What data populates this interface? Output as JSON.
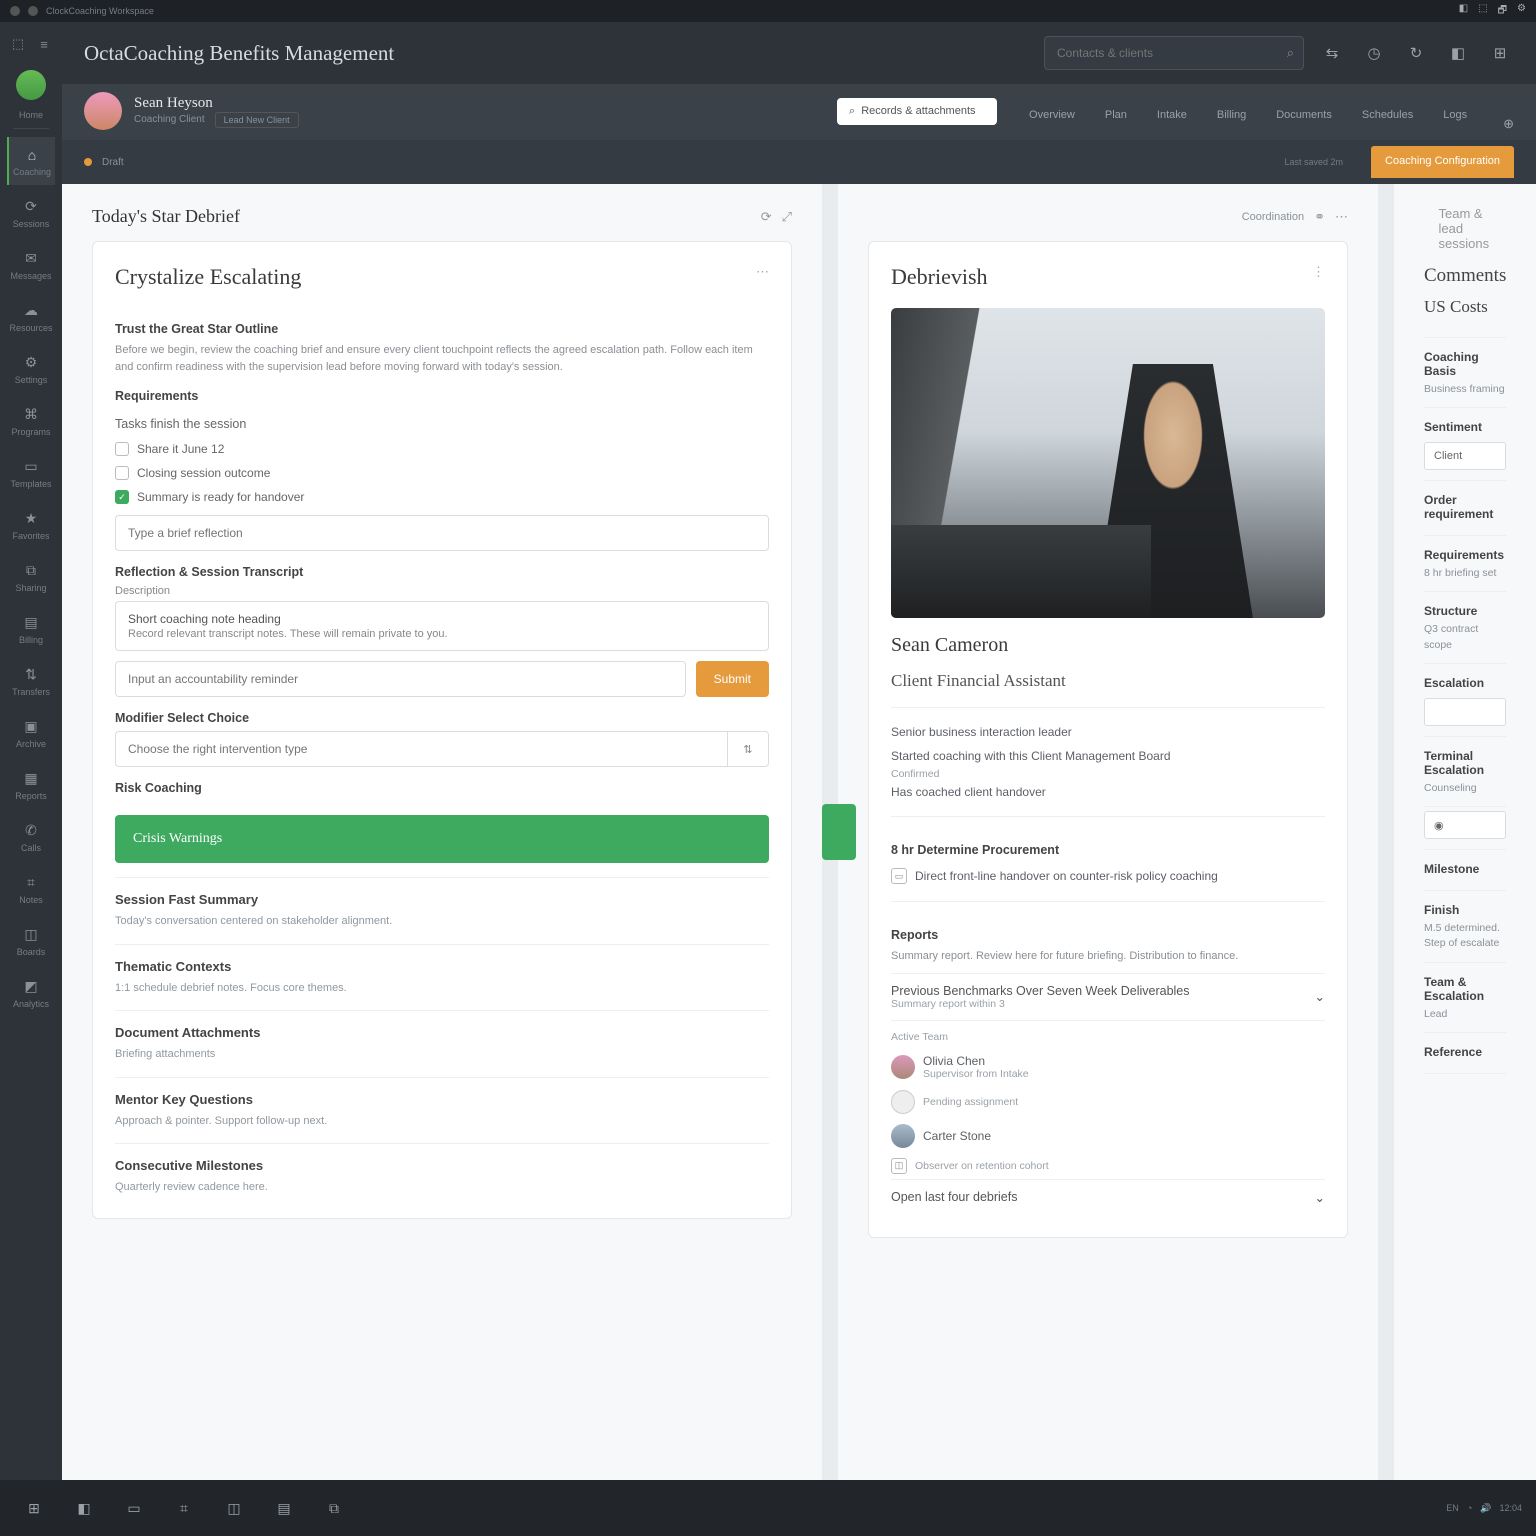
{
  "os": {
    "app_menu": "ClockCoaching Workspace",
    "tray": [
      "◧",
      "⬚",
      "🗗",
      "⚙"
    ]
  },
  "rail": {
    "items": [
      {
        "icon": "◉",
        "label": "Home"
      },
      {
        "icon": "⌂",
        "label": "Coaching",
        "sel": true
      },
      {
        "icon": "⟳",
        "label": "Sessions"
      },
      {
        "icon": "✉",
        "label": "Messages"
      },
      {
        "icon": "☁",
        "label": "Resources"
      },
      {
        "icon": "⚙",
        "label": "Settings"
      },
      {
        "icon": "⌘",
        "label": "Programs"
      },
      {
        "icon": "▭",
        "label": "Templates"
      },
      {
        "icon": "★",
        "label": "Favorites"
      },
      {
        "icon": "⧉",
        "label": "Sharing"
      },
      {
        "icon": "▤",
        "label": "Billing"
      },
      {
        "icon": "⇅",
        "label": "Transfers"
      },
      {
        "icon": "▣",
        "label": "Archive"
      },
      {
        "icon": "▦",
        "label": "Reports"
      },
      {
        "icon": "✆",
        "label": "Calls"
      },
      {
        "icon": "⌗",
        "label": "Notes"
      },
      {
        "icon": "◫",
        "label": "Boards"
      },
      {
        "icon": "◩",
        "label": "Analytics"
      }
    ]
  },
  "header": {
    "title": "OctaCoaching Benefits Management",
    "search_placeholder": "Contacts & clients",
    "tools": [
      "⇆",
      "◷",
      "↻",
      "◧",
      "⊞"
    ]
  },
  "user": {
    "name": "Sean Heyson",
    "subtitle": "Coaching Client",
    "chip_label": "Lead New Client",
    "search_placeholder": "Records & attachments"
  },
  "tabs": {
    "items": [
      "Overview",
      "Plan",
      "Intake",
      "Billing",
      "Documents",
      "Schedules",
      "Logs"
    ],
    "active_index": 0,
    "active_label": "Coaching Configuration"
  },
  "status": {
    "label": "Draft",
    "secondary": "Last saved 2m"
  },
  "left": {
    "section_title": "Today's Star Debrief",
    "card_title": "Crystalize Escalating",
    "intro_label": "Trust the Great Star Outline",
    "intro_text": "Before we begin, review the coaching brief and ensure every client touchpoint reflects the agreed escalation path. Follow each item and confirm readiness with the supervision lead before moving forward with today's session.",
    "req_label": "Requirements",
    "checklist_label": "Tasks finish the session",
    "checklist": [
      {
        "done": false,
        "text": "Share it June 12"
      },
      {
        "done": false,
        "text": "Closing session outcome"
      },
      {
        "done": true,
        "text": "Summary is ready for handover"
      }
    ],
    "field1_placeholder": "Type a brief reflection",
    "notes_label": "Reflection & Session Transcript",
    "notes_sublabel": "Description",
    "notes_area_title": "Short coaching note heading",
    "notes_area_body": "Record relevant transcript notes. These will remain private to you.",
    "input2_placeholder": "Input an accountability reminder",
    "btn_submit": "Submit",
    "modifier_label": "Modifier Select Choice",
    "modifier_placeholder": "Choose the right intervention type",
    "modifier_addon": "⇅",
    "risk_label": "Risk Coaching",
    "green_btn": "Crisis Warnings",
    "blocks": [
      {
        "title": "Session Fast Summary",
        "body": "Today's conversation centered on stakeholder alignment."
      },
      {
        "title": "Thematic Contexts",
        "body": "1:1 schedule debrief notes.\nFocus core themes."
      },
      {
        "title": "Document Attachments",
        "body": "Briefing attachments"
      },
      {
        "title": "Mentor Key Questions",
        "body": "Approach & pointer.\nSupport follow-up next."
      },
      {
        "title": "Consecutive Milestones",
        "body": "Quarterly review cadence here."
      }
    ]
  },
  "mid": {
    "card_title": "Debrievish",
    "section_ref": "Coordination",
    "meta_link": "Team & lead sessions",
    "name": "Sean Cameron",
    "role": "Client Financial Assistant",
    "lines": [
      {
        "label": "Senior business interaction leader"
      },
      {
        "label": "Started coaching with this Client Management Board",
        "sub": "Confirmed"
      },
      {
        "label": "Has coached client handover"
      }
    ],
    "sec2_label": "8 hr Determine Procurement",
    "sec2_item": "Direct front-line handover on counter-risk policy coaching",
    "reports_label": "Reports",
    "reports_text": "Summary report. Review here for future briefing. Distribution to finance.",
    "collapse1": "Previous Benchmarks Over Seven Week Deliverables",
    "collapse1_sub": "Summary report within 3",
    "people_label": "Active Team",
    "people": [
      {
        "name": "Olivia Chen",
        "role": "Supervisor from Intake"
      },
      {
        "name": "",
        "role": "Pending assignment"
      },
      {
        "name": "Carter Stone",
        "role": ""
      },
      {
        "name": "",
        "role": "Observer on retention cohort",
        "ico": true
      }
    ],
    "footer_link": "Open last four debriefs"
  },
  "right": {
    "section_title": "Comments",
    "meta_link": "Team & lead sessions",
    "panel_title": "US Costs",
    "blocks": [
      {
        "label": "Coaching Basis",
        "sub": "Business framing"
      },
      {
        "label2": "Sentiment",
        "input": "Client"
      },
      {
        "label": "Order requirement",
        "sub": ""
      },
      {
        "label": "Requirements",
        "sub": "8 hr briefing set"
      },
      {
        "label": "Structure",
        "sub": "Q3 contract scope"
      },
      {
        "label2": "Escalation",
        "input": ""
      },
      {
        "label": "Terminal Escalation",
        "sub": "Counseling"
      },
      {
        "label2": "",
        "input": "◉"
      },
      {
        "label": "Milestone",
        "sub": ""
      },
      {
        "label": "Finish",
        "sub": "M.5 determined.\nStep of escalate"
      },
      {
        "label": "Team & Escalation",
        "sub": "Lead"
      },
      {
        "label": "Reference",
        "sub": ""
      }
    ]
  },
  "taskbar": {
    "items": [
      "⊞",
      "◧",
      "▭",
      "⌗",
      "◫",
      "▤",
      "⧉"
    ],
    "right": [
      "EN",
      "◔",
      "🔊",
      "12:04"
    ]
  }
}
